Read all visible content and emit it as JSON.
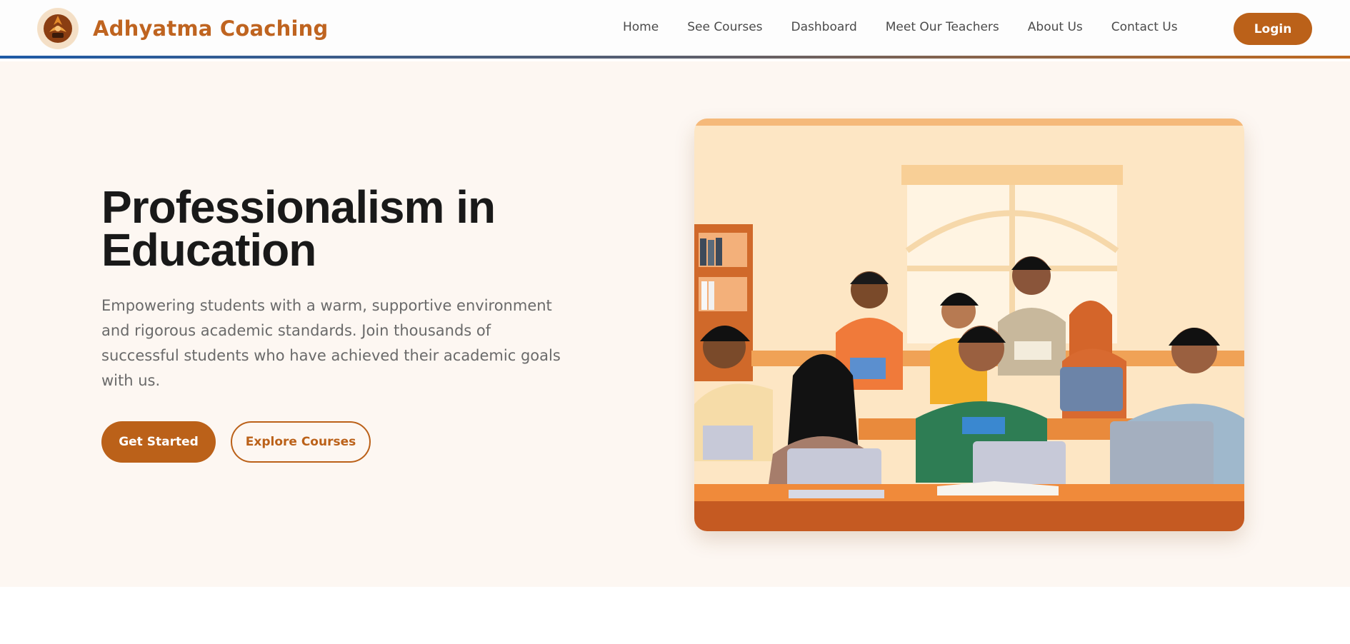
{
  "header": {
    "brand": "Adhyatma Coaching",
    "logo_icon": "emblem-logo-icon",
    "nav": [
      "Home",
      "See Courses",
      "Dashboard",
      "Meet Our Teachers",
      "About Us",
      "Contact Us"
    ],
    "login_label": "Login"
  },
  "hero": {
    "title": "Professionalism in Education",
    "subtitle": "Empowering students with a warm, supportive environment and rigorous academic standards. Join thousands of successful students who have achieved their academic goals with us.",
    "primary_cta": "Get Started",
    "secondary_cta": "Explore Courses",
    "image_icon": "classroom-illustration"
  },
  "colors": {
    "brand": "#bb6119",
    "hero_bg": "#fdf7f2",
    "text_dark": "#191919",
    "text_muted": "#6a6a6a"
  }
}
